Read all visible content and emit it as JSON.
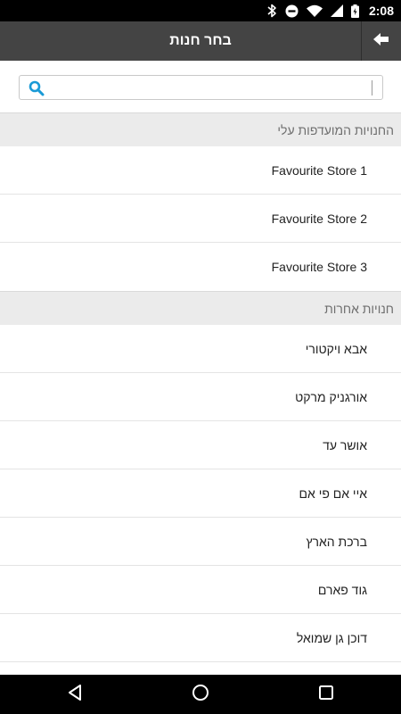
{
  "status_bar": {
    "time": "2:08",
    "icons": [
      "bluetooth-icon",
      "do-not-disturb-icon",
      "wifi-icon",
      "signal-icon",
      "battery-icon"
    ]
  },
  "action_bar": {
    "title": "בחר חנות",
    "back_icon": "arrow-back-icon",
    "background": "#444444"
  },
  "search": {
    "placeholder": "",
    "value": "",
    "icon": "search-icon",
    "icon_color": "#1a9ad6"
  },
  "sections": [
    {
      "header": "החנויות המועדפות עלי",
      "items": [
        "Favourite Store 1",
        "Favourite Store 2",
        "Favourite Store 3"
      ]
    },
    {
      "header": "חנויות אחרות",
      "items": [
        "אבא ויקטורי",
        "אורגניק מרקט",
        "אושר עד",
        "איי אם פי אם",
        "ברכת הארץ",
        "גוד פארם",
        "דוכן גן שמואל"
      ]
    }
  ],
  "nav_bar": {
    "icons": [
      "back-triangle-icon",
      "home-circle-icon",
      "recents-square-icon"
    ]
  }
}
